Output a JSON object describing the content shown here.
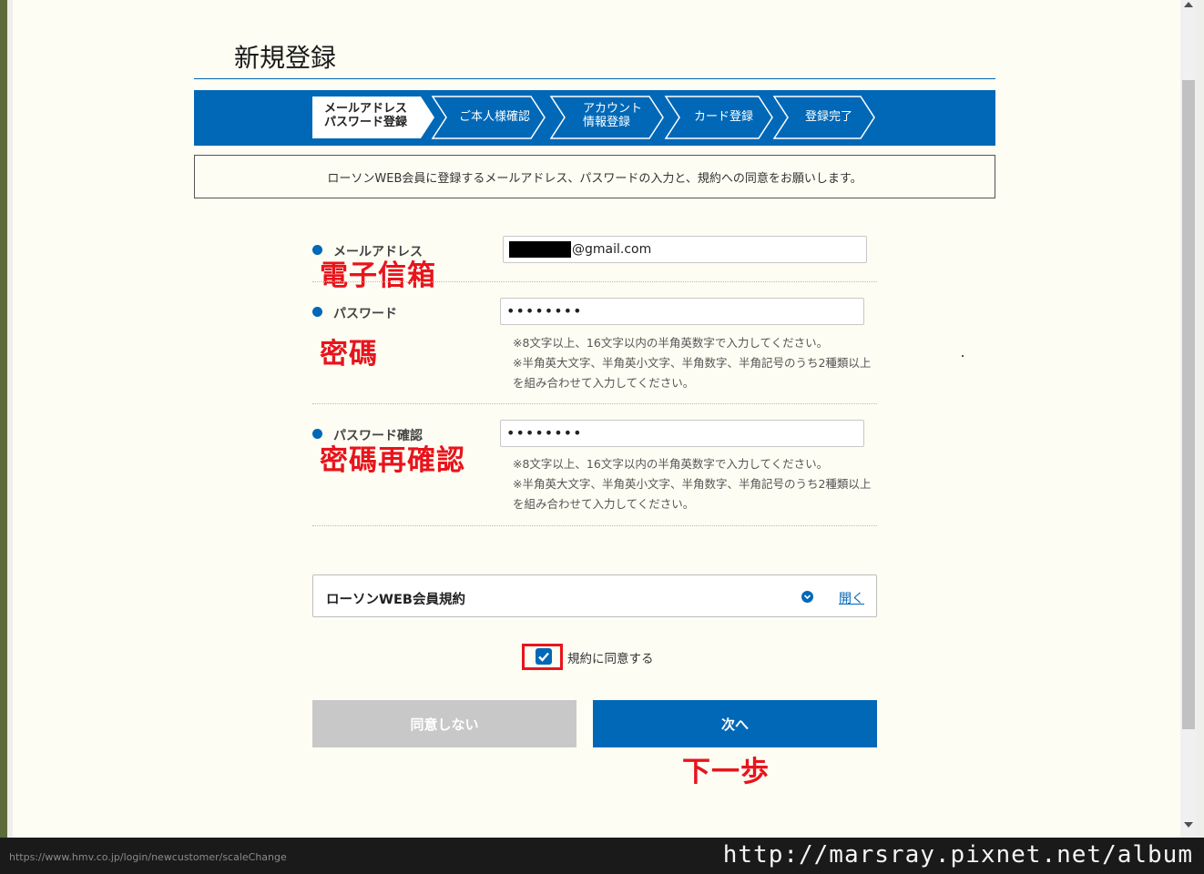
{
  "page": {
    "title": "新規登録",
    "intro": "ローソンWEB会員に登録するメールアドレス、パスワードの入力と、規約への同意をお願いします。"
  },
  "steps": [
    {
      "label": "メールアドレス\nパスワード登録",
      "active": true
    },
    {
      "label": "ご本人様確認",
      "active": false
    },
    {
      "label": "アカウント\n情報登録",
      "active": false
    },
    {
      "label": "カード登録",
      "active": false
    },
    {
      "label": "登録完了",
      "active": false
    }
  ],
  "form": {
    "email": {
      "label": "メールアドレス",
      "value": "@gmail.com",
      "annotation": "電子信箱"
    },
    "password": {
      "label": "パスワード",
      "value": "••••••••",
      "annotation": "密碼",
      "hint": "※8文字以上、16文字以内の半角英数字で入力してください。\n※半角英大文字、半角英小文字、半角数字、半角記号のうち2種類以上\nを組み合わせて入力してください。"
    },
    "password_confirm": {
      "label": "パスワード確認",
      "value": "••••••••",
      "annotation": "密碼再確認",
      "hint": "※8文字以上、16文字以内の半角英数字で入力してください。\n※半角英大文字、半角英小文字、半角数字、半角記号のうち2種類以上\nを組み合わせて入力してください。"
    }
  },
  "terms": {
    "title": "ローソンWEB会員規約",
    "open_label": "開く",
    "agree_label": "規約に同意する",
    "agree_checked": true
  },
  "buttons": {
    "disagree": "同意しない",
    "next": "次へ",
    "next_annotation": "下一歩"
  },
  "status_bar": {
    "url": "https://www.hmv.co.jp/login/newcustomer/scaleChange"
  },
  "watermark": "http://marsray.pixnet.net/album",
  "colors": {
    "brand": "#0068b7",
    "annotation": "#e8141c",
    "background": "#fdfdf3"
  }
}
